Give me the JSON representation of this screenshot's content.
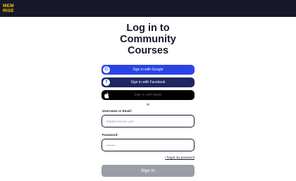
{
  "header": {
    "logo_line1": "MEM",
    "logo_line2": "RISE",
    "colors": {
      "bar": "#16172a",
      "logo": "#ffc600"
    }
  },
  "page": {
    "title_line1": "Log in to",
    "title_line2": "Community",
    "title_line3": "Courses"
  },
  "sso": {
    "google": {
      "label": "Sign in with Google",
      "icon": "google-icon",
      "color": "#2b44e6"
    },
    "facebook": {
      "label": "Sign in with Facebook",
      "icon": "facebook-icon",
      "color": "#1f2660"
    },
    "apple": {
      "label": "Sign in with Apple",
      "icon": "apple-icon",
      "color": "#000000"
    }
  },
  "divider": "or",
  "form": {
    "username_label": "Username or Email:",
    "username_placeholder": "bob@memrise.com",
    "username_value": "",
    "password_label": "Password:",
    "password_placeholder": "••••••••",
    "password_value": "",
    "forgot_label": "I forgot my password",
    "submit_label": "Sign in"
  }
}
